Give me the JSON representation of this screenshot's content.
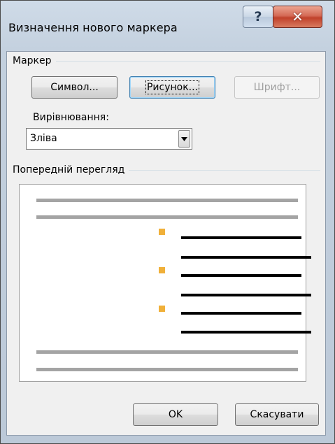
{
  "window": {
    "title": "Визначення нового маркера",
    "help_glyph": "?",
    "close_glyph": "✕"
  },
  "marker_group": {
    "legend": "Маркер",
    "symbol_button": "Символ...",
    "picture_button": "Рисунок...",
    "font_button": "Шрифт..."
  },
  "alignment": {
    "label": "Вирівнювання:",
    "selected": "Зліва"
  },
  "preview": {
    "legend": "Попередній перегляд",
    "bullet_color": "#f0b039",
    "bullet_count": 3
  },
  "footer": {
    "ok_button": "OK",
    "cancel_button": "Скасувати"
  }
}
